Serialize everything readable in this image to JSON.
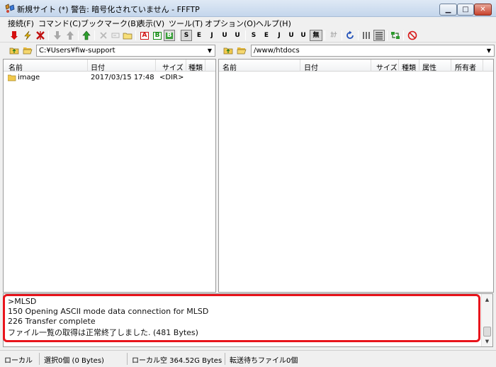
{
  "window": {
    "title": "新規サイト (*) 警告: 暗号化されていません - FFFTP"
  },
  "menu": [
    {
      "label": "接続(F)"
    },
    {
      "label": "コマンド(C)"
    },
    {
      "label": "ブックマーク(B)"
    },
    {
      "label": "表示(V)"
    },
    {
      "label": "ツール(T)"
    },
    {
      "label": "オプション(O)"
    },
    {
      "label": "ヘルプ(H)"
    }
  ],
  "toolbar": {
    "icons": [
      "connect-icon",
      "quick-connect-icon",
      "disconnect-icon",
      "download-icon",
      "upload-icon",
      "mirror-upload-icon",
      "delete-icon",
      "rename-icon",
      "mkdir-icon",
      "ascii-mode-icon",
      "binary-mode-icon",
      "auto-mode-icon",
      "sjis-icon",
      "euc-icon",
      "jis-icon",
      "utf8-icon",
      "utf8bom-icon",
      "sjis-remote-icon",
      "euc-remote-icon",
      "jis-remote-icon",
      "utf8-remote-icon",
      "utf8bom-remote-icon",
      "no-convert-icon",
      "kana-icon",
      "refresh-icon",
      "list-view-icon",
      "detail-view-icon",
      "sync-dir-icon",
      "stop-icon"
    ],
    "text": {
      "ascii": "A",
      "binary": "B",
      "auto": "B",
      "sjis": "S",
      "euc": "E",
      "jis": "J",
      "utf8": "U",
      "utf8bom": "U",
      "noconv": "無",
      "kana": "ｶﾅ"
    }
  },
  "local": {
    "path": "C:¥Users¥fiw-support",
    "columns": [
      "名前",
      "日付",
      "サイズ",
      "種類"
    ],
    "rows": [
      {
        "name": "image",
        "date": "2017/03/15 17:48",
        "size": "<DIR>",
        "type": ""
      }
    ]
  },
  "remote": {
    "path": "/www/htdocs",
    "columns": [
      "名前",
      "日付",
      "サイズ",
      "種類",
      "属性",
      "所有者"
    ],
    "rows": []
  },
  "log": {
    "lines": [
      ">MLSD",
      "150 Opening ASCII mode data connection for MLSD",
      "226 Transfer complete",
      "ファイル一覧の取得は正常終了しました. (481 Bytes)"
    ]
  },
  "status": {
    "mode": "ローカル",
    "selection": "選択0個 (0 Bytes)",
    "free_space": "ローカル空 364.52G Bytes",
    "queue": "転送待ちファイル0個"
  },
  "colors": {
    "highlight": "#e8141c",
    "folder": "#f2c94c"
  }
}
